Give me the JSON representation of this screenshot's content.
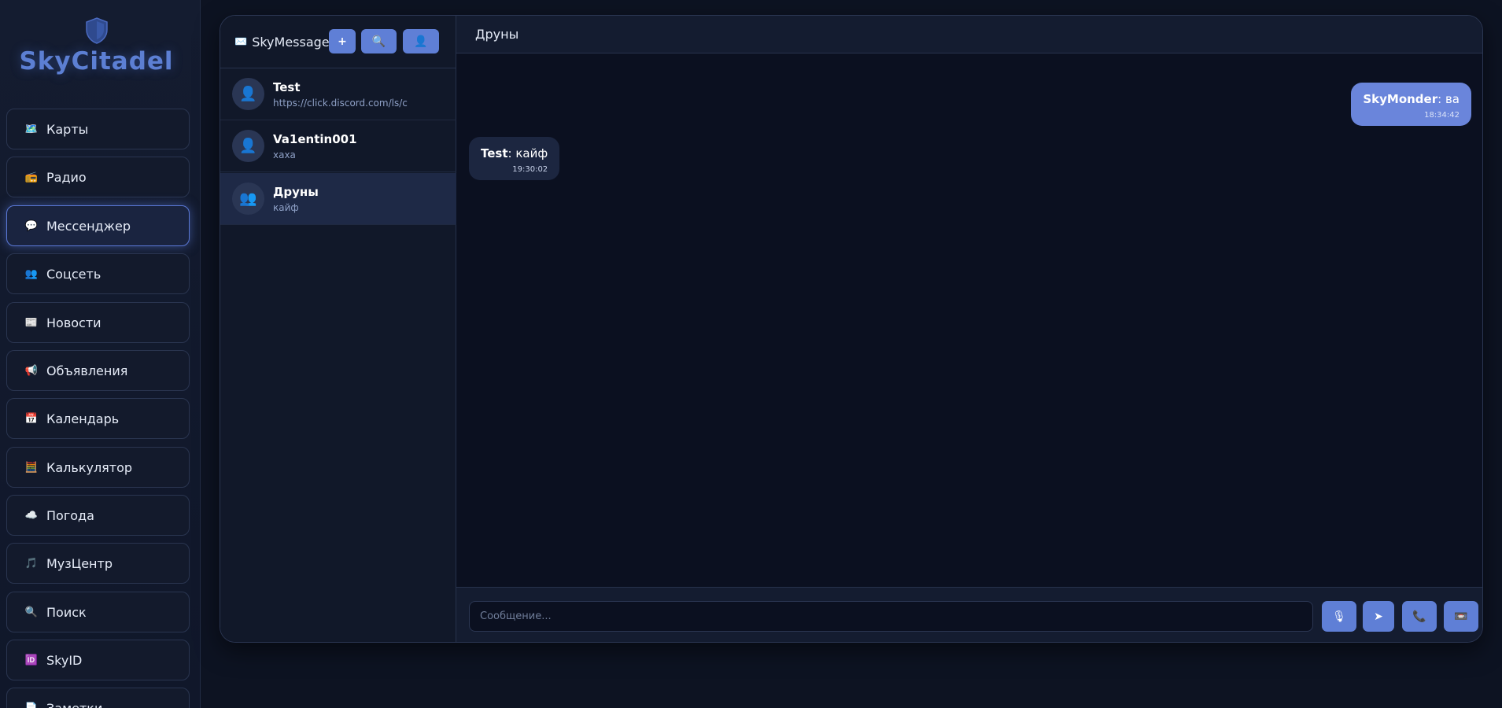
{
  "brand": {
    "title": "SkyCitadel",
    "icon": "shield-icon",
    "color": "#5c7fd3"
  },
  "sidebar": {
    "items": [
      {
        "icon": "🗺️",
        "icon_name": "map-icon",
        "label": "Карты"
      },
      {
        "icon": "📻",
        "icon_name": "radio-icon",
        "label": "Радио"
      },
      {
        "icon": "💬",
        "icon_name": "speech-bubble-icon",
        "label": "Мессенджер",
        "active": true
      },
      {
        "icon": "👥",
        "icon_name": "people-icon",
        "label": "Соцсеть"
      },
      {
        "icon": "📰",
        "icon_name": "newspaper-icon",
        "label": "Новости"
      },
      {
        "icon": "📢",
        "icon_name": "megaphone-icon",
        "label": "Объявления"
      },
      {
        "icon": "📅",
        "icon_name": "calendar-icon",
        "label": "Календарь"
      },
      {
        "icon": "🧮",
        "icon_name": "abacus-icon",
        "label": "Калькулятор"
      },
      {
        "icon": "☁️",
        "icon_name": "cloud-icon",
        "label": "Погода"
      },
      {
        "icon": "🎵",
        "icon_name": "music-icon",
        "label": "МузЦентр"
      },
      {
        "icon": "🔍",
        "icon_name": "search-icon",
        "label": "Поиск"
      },
      {
        "icon": "🆔",
        "icon_name": "id-icon",
        "label": "SkyID"
      },
      {
        "icon": "📄",
        "icon_name": "document-icon",
        "label": "Заметки"
      }
    ]
  },
  "messenger": {
    "app_name": "SkyMessage",
    "app_icon": "✉️",
    "buttons": {
      "new": "+",
      "search_icon": "🔍",
      "profile_icon": "👤"
    },
    "chats": [
      {
        "name": "Test",
        "preview": "https://click.discord.com/ls/c",
        "avatar": "👤"
      },
      {
        "name": "Va1entin001",
        "preview": "хаха",
        "avatar": "👤"
      },
      {
        "name": "Друны",
        "preview": "кайф",
        "avatar": "👥",
        "active": true
      }
    ],
    "active_chat_title": "Друны",
    "messages": [
      {
        "direction": "out",
        "sender": "SkyMonder",
        "text": "ва",
        "time": "18:34:42"
      },
      {
        "direction": "in",
        "sender": "Test",
        "text": "кайф",
        "time": "19:30:02"
      }
    ],
    "composer": {
      "placeholder": "Сообщение...",
      "mic_icon": "🎙",
      "send_icon": "➤",
      "call_icon": "📞",
      "video_icon": "📼"
    }
  },
  "colors": {
    "accent": "#5f7fd6",
    "background": "#0b1020",
    "sidebar": "#131a2c"
  }
}
